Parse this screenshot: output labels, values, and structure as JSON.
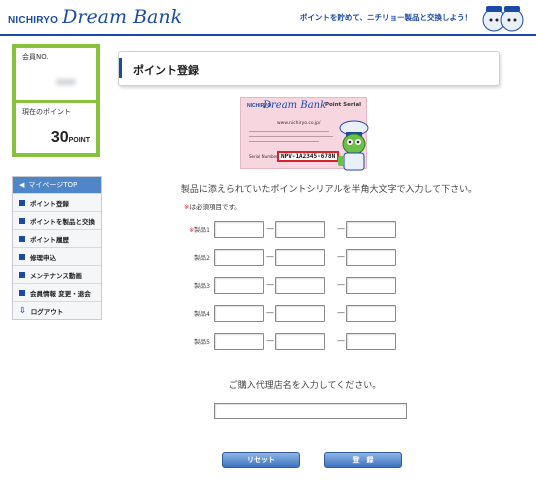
{
  "header": {
    "logo_corp": "NICHIRYO",
    "logo_dream": "Dream Bank",
    "tagline": "ポイントを貯めて、ニチリョー製品と交換しよう！"
  },
  "member": {
    "number_label": "会員NO.",
    "points_label": "現在のポイント",
    "points_value": "30",
    "points_unit": "POINT"
  },
  "menu": {
    "top_label": "マイページTOP",
    "items": [
      {
        "label": "ポイント登録"
      },
      {
        "label": "ポイントを製品と交換"
      },
      {
        "label": "ポイント履歴"
      },
      {
        "label": "修理申込"
      },
      {
        "label": "メンテナンス動画"
      },
      {
        "label": "会員情報 変更・退会"
      },
      {
        "label": "ログアウト"
      }
    ]
  },
  "main": {
    "title": "ポイント登録",
    "card": {
      "brand": "NICHIRYO",
      "dream": "Dream Bank",
      "point_serial": "Point Serial",
      "url": "www.nichiryo.co.jp/",
      "serial_label": "Serial Number",
      "serial_value": "NPV-1A2345-678N"
    },
    "instruction": "製品に添えられていたポイントシリアルを半角大文字で入力して下さい。",
    "required_mark": "※",
    "required_note": "は必須項目です。",
    "products": [
      {
        "label": "製品1",
        "required": true
      },
      {
        "label": "製品2",
        "required": false
      },
      {
        "label": "製品3",
        "required": false
      },
      {
        "label": "製品4",
        "required": false
      },
      {
        "label": "製品5",
        "required": false
      }
    ],
    "dash": "—",
    "store_label": "ご購入代理店名を入力してください。",
    "reset_button": "リセット",
    "register_button": "登　録"
  },
  "colors": {
    "brand_blue": "#1b4aa8",
    "sidebar_green": "#88c13c",
    "button_blue": "#3d72bf",
    "required_red": "#d8232a"
  }
}
